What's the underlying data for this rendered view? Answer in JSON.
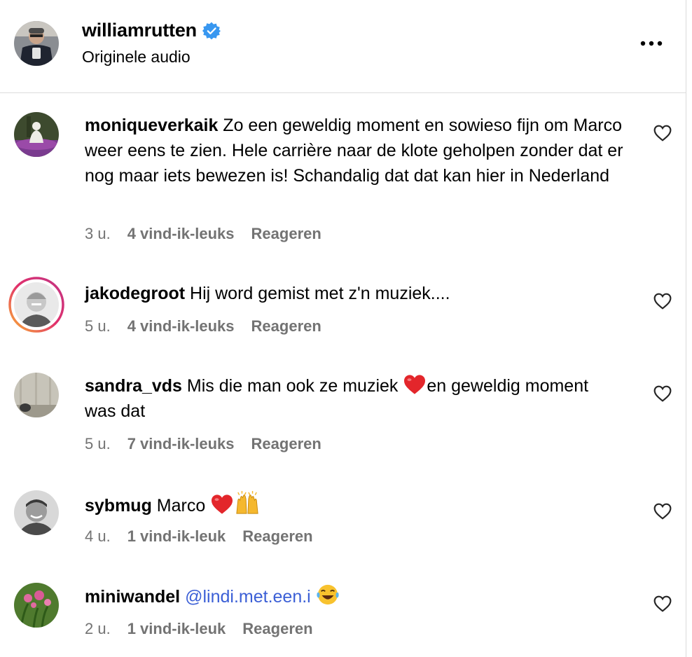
{
  "header": {
    "username": "williamrutten",
    "subtitle": "Originele audio",
    "verified_color": "#3897f0"
  },
  "comments": [
    {
      "username": "moniqueverkaik",
      "text": " Zo een geweldig moment en sowieso fijn om Marco weer eens te zien. Hele carrière naar de klote geholpen zonder dat er nog maar iets bewezen is! Schandalig dat dat kan hier in Nederland",
      "time": "3 u.",
      "likes": "4 vind-ik-leuks",
      "reply": "Reageren"
    },
    {
      "username": "jakodegroot",
      "text": " Hij word gemist met z'n muziek....",
      "time": "5 u.",
      "likes": "4 vind-ik-leuks",
      "reply": "Reageren"
    },
    {
      "username": "sandra_vds",
      "text_before": " Mis die man ook ze muziek ",
      "emoji": "red-heart",
      "text_after": "en geweldig moment was dat",
      "time": "5 u.",
      "likes": "7 vind-ik-leuks",
      "reply": "Reageren"
    },
    {
      "username": "sybmug",
      "text": " Marco ",
      "emojis": [
        "red-heart",
        "raising-hands"
      ],
      "time": "4 u.",
      "likes": "1 vind-ik-leuk",
      "reply": "Reageren"
    },
    {
      "username": "miniwandel",
      "mention": "@lindi.met.een.i",
      "emoji": "tears-of-joy",
      "time": "2 u.",
      "likes": "1 vind-ik-leuk",
      "reply": "Reageren"
    }
  ],
  "icons": {
    "more": "more-horizontal-icon",
    "like": "heart-outline-icon"
  }
}
